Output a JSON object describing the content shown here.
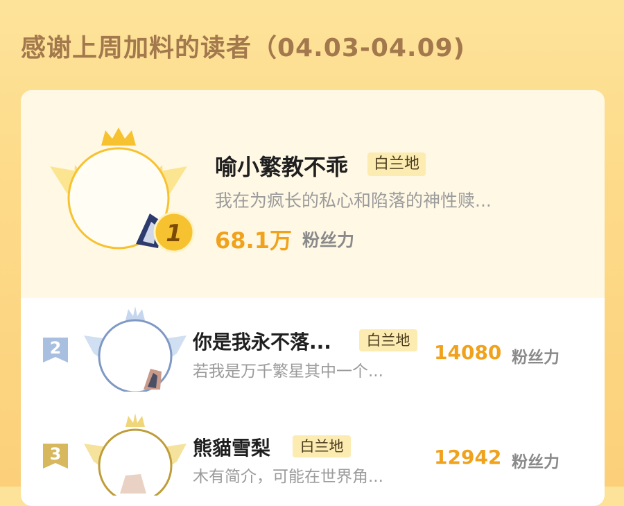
{
  "header": {
    "title": "感谢上周加料的读者（04.03-04.09)"
  },
  "top_reader": {
    "rank": "1",
    "name": "喻小繁教不乖",
    "badge": "白兰地",
    "description": "我在为疯长的私心和陷落的神性赎...",
    "fan_power_value": "68.1万",
    "fan_power_unit": "粉丝力"
  },
  "readers": [
    {
      "rank": "2",
      "name": "你是我永不落...",
      "badge": "白兰地",
      "description": "若我是万千繁星其中一个...",
      "fan_power_value": "14080",
      "fan_power_unit": "粉丝力"
    },
    {
      "rank": "3",
      "name": "熊貓雪梨",
      "badge": "白兰地",
      "description": "木有简介，可能在世界角...",
      "fan_power_value": "12942",
      "fan_power_unit": "粉丝力"
    }
  ],
  "colors": {
    "accent": "#f0a21c",
    "gold": "#f6c230",
    "silver": "#8ea9d1",
    "bronze": "#d6b85a"
  }
}
